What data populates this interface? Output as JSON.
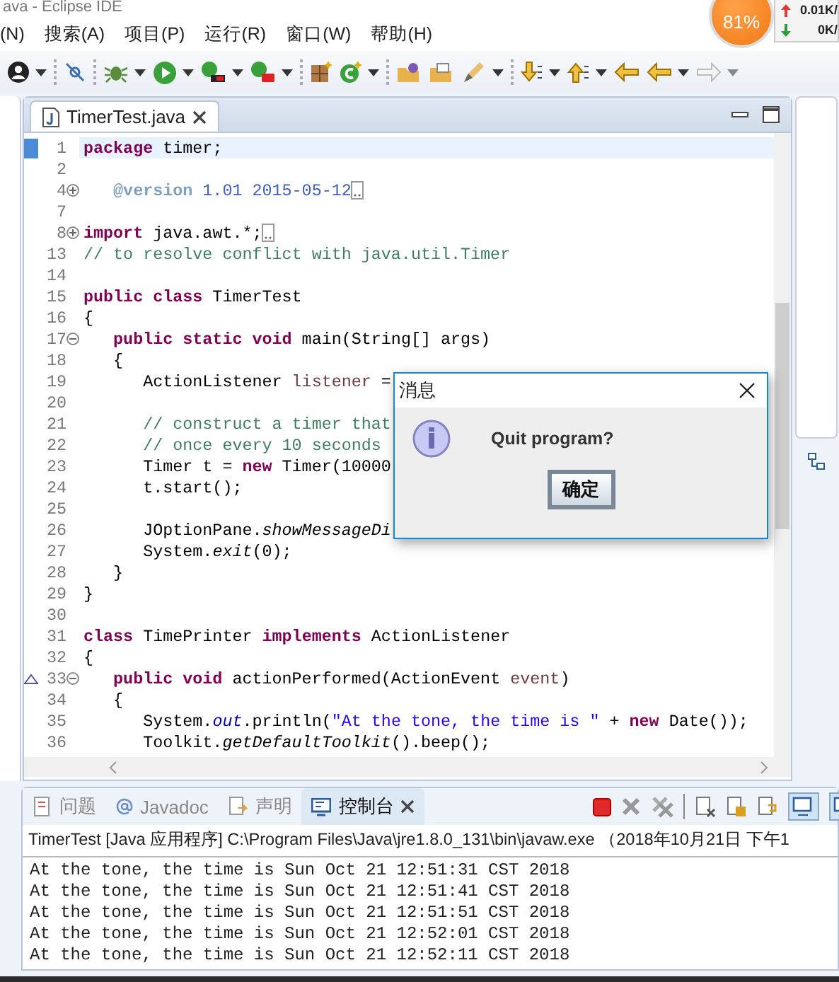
{
  "window": {
    "title": "ava - Eclipse IDE"
  },
  "menu": [
    "(N)",
    "搜索(A)",
    "项目(P)",
    "运行(R)",
    "窗口(W)",
    "帮助(H)"
  ],
  "net_monitor": {
    "percent": "81%",
    "up": "0.01K/",
    "down": "0K/"
  },
  "editor": {
    "tabs": [
      {
        "label": "TimerTest.java",
        "selected": true
      }
    ],
    "lines": [
      {
        "number": "1",
        "current": true,
        "segments": [
          {
            "kind": "kw",
            "text": "package"
          },
          {
            "kind": "plain",
            "text": " timer;"
          }
        ]
      },
      {
        "number": "2"
      },
      {
        "number": "4",
        "folded": true,
        "segments": [
          {
            "kind": "doctag",
            "text": "   @version"
          },
          {
            "kind": "doc",
            "text": " 1.01 2015-05-12"
          }
        ]
      },
      {
        "number": "7"
      },
      {
        "number": "8",
        "folded": true,
        "segments": [
          {
            "kind": "kw",
            "text": "import"
          },
          {
            "kind": "plain",
            "text": " java.awt.*;"
          }
        ]
      },
      {
        "number": "13",
        "segments": [
          {
            "kind": "comment",
            "text": "// to resolve conflict with java.util.Timer"
          }
        ]
      },
      {
        "number": "14"
      },
      {
        "number": "15",
        "segments": [
          {
            "kind": "kw",
            "text": "public class"
          },
          {
            "kind": "plain",
            "text": " TimerTest"
          }
        ]
      },
      {
        "number": "16",
        "segments": [
          {
            "kind": "plain",
            "text": "{"
          }
        ]
      },
      {
        "number": "17",
        "folded": false,
        "segments": [
          {
            "kind": "kw",
            "text": "   public static void"
          },
          {
            "kind": "plain",
            "text": " main(String[] args)"
          }
        ]
      },
      {
        "number": "18",
        "segments": [
          {
            "kind": "plain",
            "text": "   {"
          }
        ]
      },
      {
        "number": "19",
        "segments": [
          {
            "kind": "plain",
            "text": "      ActionListener "
          },
          {
            "kind": "local",
            "text": "listener"
          },
          {
            "kind": "plain",
            "text": " ="
          }
        ]
      },
      {
        "number": "20"
      },
      {
        "number": "21",
        "segments": [
          {
            "kind": "comment",
            "text": "      // construct a timer that"
          }
        ]
      },
      {
        "number": "22",
        "segments": [
          {
            "kind": "comment",
            "text": "      // once every 10 seconds"
          }
        ]
      },
      {
        "number": "23",
        "segments": [
          {
            "kind": "plain",
            "text": "      Timer t = "
          },
          {
            "kind": "kw",
            "text": "new"
          },
          {
            "kind": "plain",
            "text": " Timer(10000"
          }
        ]
      },
      {
        "number": "24",
        "segments": [
          {
            "kind": "plain",
            "text": "      t.start();"
          }
        ]
      },
      {
        "number": "25"
      },
      {
        "number": "26",
        "segments": [
          {
            "kind": "plain",
            "text": "      JOptionPane."
          },
          {
            "kind": "static",
            "text": "showMessageDi"
          }
        ]
      },
      {
        "number": "27",
        "segments": [
          {
            "kind": "plain",
            "text": "      System."
          },
          {
            "kind": "static",
            "text": "exit"
          },
          {
            "kind": "plain",
            "text": "(0);"
          }
        ]
      },
      {
        "number": "28",
        "segments": [
          {
            "kind": "plain",
            "text": "   }"
          }
        ]
      },
      {
        "number": "29",
        "segments": [
          {
            "kind": "plain",
            "text": "}"
          }
        ]
      },
      {
        "number": "30"
      },
      {
        "number": "31",
        "segments": [
          {
            "kind": "kw",
            "text": "class"
          },
          {
            "kind": "plain",
            "text": " TimePrinter "
          },
          {
            "kind": "kw",
            "text": "implements"
          },
          {
            "kind": "plain",
            "text": " ActionListener"
          }
        ]
      },
      {
        "number": "32",
        "segments": [
          {
            "kind": "plain",
            "text": "{"
          }
        ]
      },
      {
        "number": "33",
        "folded": false,
        "override": true,
        "segments": [
          {
            "kind": "kw",
            "text": "   public void"
          },
          {
            "kind": "plain",
            "text": " actionPerformed(ActionEvent "
          },
          {
            "kind": "local",
            "text": "event"
          },
          {
            "kind": "plain",
            "text": ")"
          }
        ]
      },
      {
        "number": "34",
        "segments": [
          {
            "kind": "plain",
            "text": "   {"
          }
        ]
      },
      {
        "number": "35",
        "segments": [
          {
            "kind": "plain",
            "text": "      System."
          },
          {
            "kind": "field",
            "text": "out"
          },
          {
            "kind": "plain",
            "text": ".println("
          },
          {
            "kind": "string",
            "text": "\"At the tone, the time is \""
          },
          {
            "kind": "plain",
            "text": " + "
          },
          {
            "kind": "kw",
            "text": "new"
          },
          {
            "kind": "plain",
            "text": " Date());"
          }
        ]
      },
      {
        "number": "36",
        "segments": [
          {
            "kind": "plain",
            "text": "      Toolkit."
          },
          {
            "kind": "static",
            "text": "getDefaultToolkit"
          },
          {
            "kind": "plain",
            "text": "().beep();"
          }
        ]
      }
    ]
  },
  "dialog": {
    "title": "消息",
    "message": "Quit program?",
    "button": "确定"
  },
  "bottom_panel": {
    "tabs": [
      {
        "label": "问题",
        "selected": false
      },
      {
        "label": "Javadoc",
        "selected": false
      },
      {
        "label": "声明",
        "selected": false
      },
      {
        "label": "控制台",
        "selected": true
      }
    ],
    "console_header": "TimerTest [Java 应用程序] C:\\Program Files\\Java\\jre1.8.0_131\\bin\\javaw.exe （2018年10月21日 下午1",
    "console_lines": [
      "At the tone, the time is Sun Oct 21 12:51:31 CST 2018",
      "At the tone, the time is Sun Oct 21 12:51:41 CST 2018",
      "At the tone, the time is Sun Oct 21 12:51:51 CST 2018",
      "At the tone, the time is Sun Oct 21 12:52:01 CST 2018",
      "At the tone, the time is Sun Oct 21 12:52:11 CST 2018"
    ]
  }
}
